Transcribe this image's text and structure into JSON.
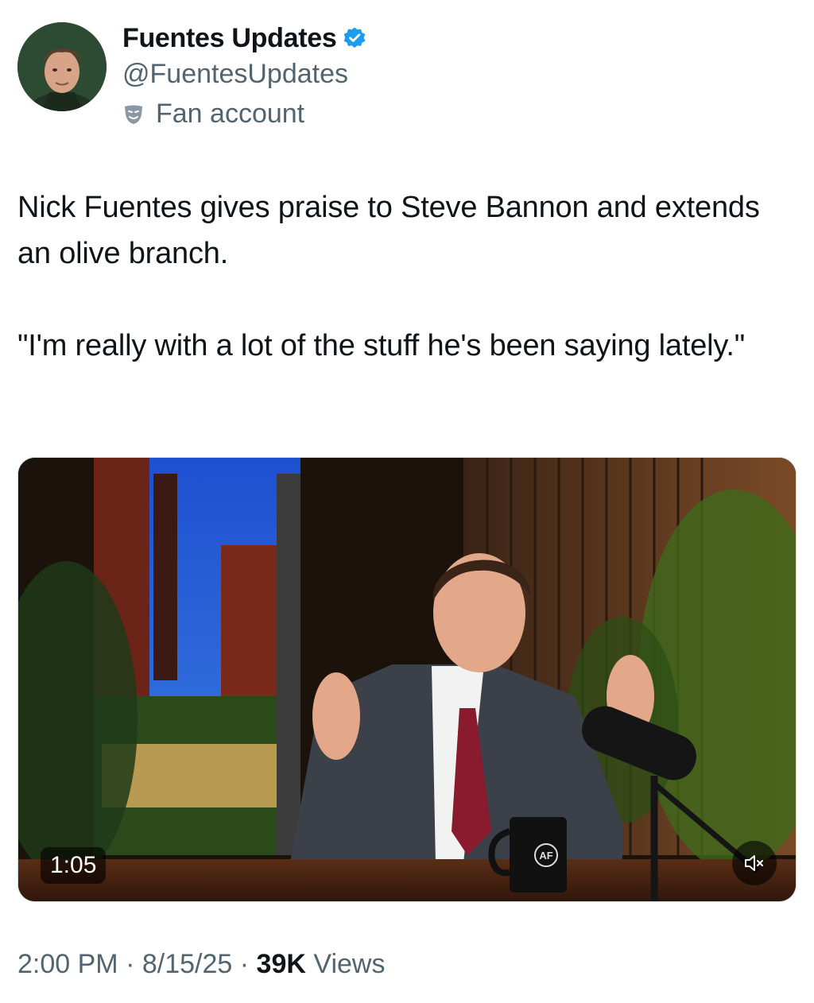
{
  "author": {
    "display_name": "Fuentes Updates",
    "handle": "@FuentesUpdates",
    "account_label": "Fan account",
    "verified": true,
    "avatar_icon": "profile-photo",
    "verified_icon": "verified-badge-icon",
    "label_icon": "theater-mask-icon"
  },
  "tweet": {
    "text_line1": "Nick Fuentes gives praise to Steve Bannon and extends an olive branch.",
    "text_line2": "\"I'm really with a lot of the stuff he's been saying lately.\""
  },
  "media": {
    "type": "video",
    "duration": "1:05",
    "muted": true,
    "mute_icon": "volume-muted-icon",
    "mug_logo": "AF"
  },
  "meta": {
    "time": "2:00 PM",
    "separator": "·",
    "date": "8/15/25",
    "views_count": "39K",
    "views_label": "Views"
  },
  "colors": {
    "text_primary": "#0f1419",
    "text_secondary": "#536471",
    "verified_blue": "#1d9bf0"
  }
}
